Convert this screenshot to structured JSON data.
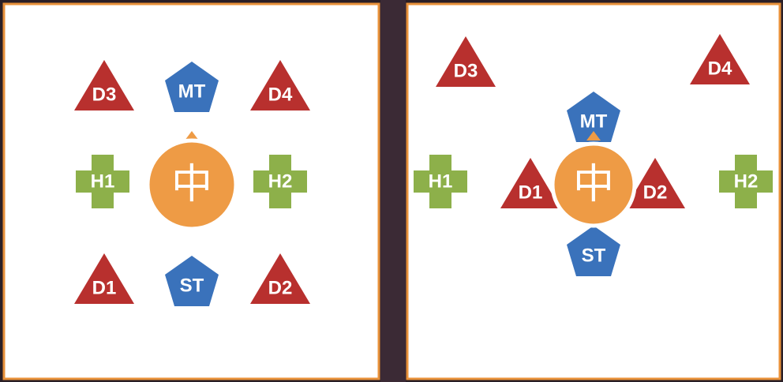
{
  "colors": {
    "dps": "#b8302e",
    "tank": "#3a72bb",
    "healer": "#8db04a",
    "center": "#ee9b45",
    "border": "#e8913a"
  },
  "left_panel": {
    "markers": {
      "d3": "D3",
      "mt": "MT",
      "d4": "D4",
      "h1": "H1",
      "h2": "H2",
      "d1": "D1",
      "st": "ST",
      "d2": "D2"
    },
    "center": "中"
  },
  "right_panel": {
    "markers": {
      "d3": "D3",
      "mt": "MT",
      "d4": "D4",
      "h1": "H1",
      "h2": "H2",
      "d1": "D1",
      "st": "ST",
      "d2": "D2"
    },
    "center": "中"
  }
}
